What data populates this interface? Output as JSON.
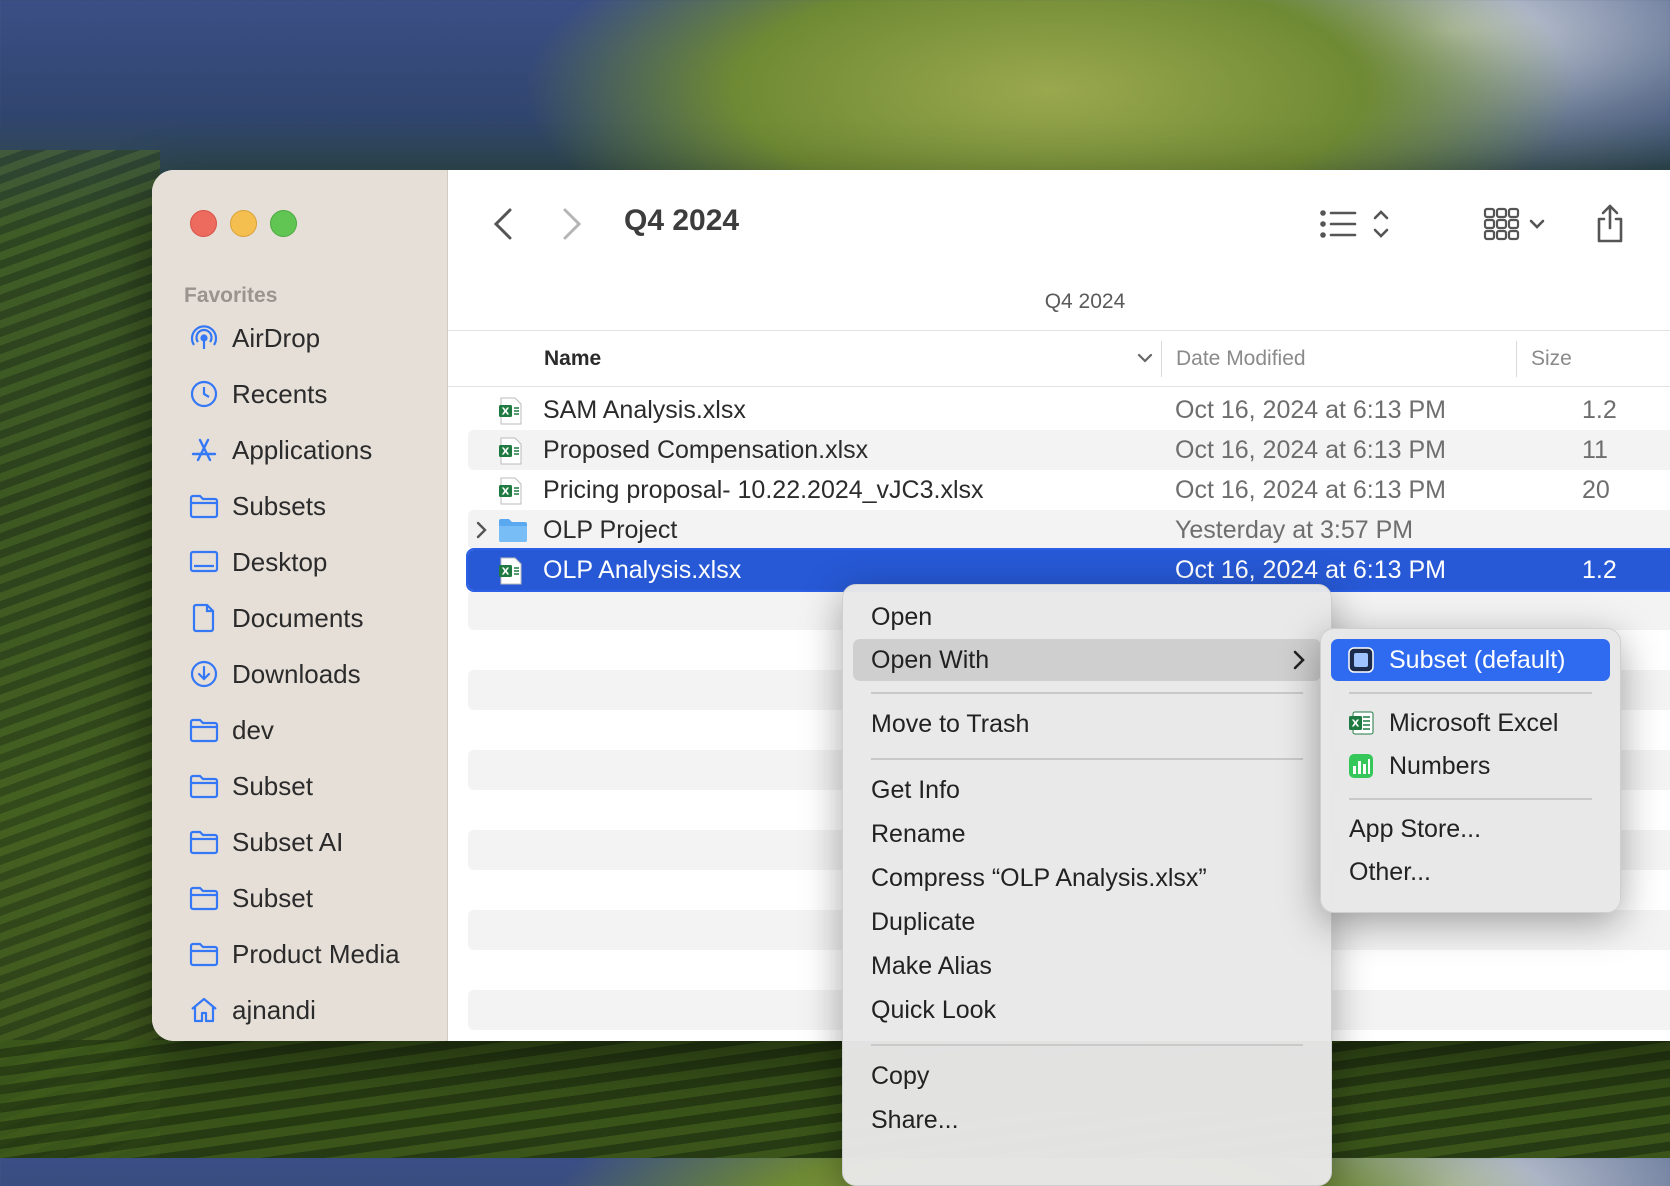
{
  "window": {
    "title": "Q4 2024",
    "path_title": "Q4 2024"
  },
  "sidebar": {
    "section_label": "Favorites",
    "items": [
      {
        "label": "AirDrop",
        "icon": "airdrop-icon"
      },
      {
        "label": "Recents",
        "icon": "clock-icon"
      },
      {
        "label": "Applications",
        "icon": "applications-icon"
      },
      {
        "label": "Subsets",
        "icon": "folder-icon"
      },
      {
        "label": "Desktop",
        "icon": "desktop-icon"
      },
      {
        "label": "Documents",
        "icon": "document-icon"
      },
      {
        "label": "Downloads",
        "icon": "download-icon"
      },
      {
        "label": "dev",
        "icon": "folder-icon"
      },
      {
        "label": "Subset",
        "icon": "folder-icon"
      },
      {
        "label": "Subset AI",
        "icon": "folder-icon"
      },
      {
        "label": "Subset",
        "icon": "folder-icon"
      },
      {
        "label": "Product Media",
        "icon": "folder-icon"
      },
      {
        "label": "ajnandi",
        "icon": "home-icon"
      }
    ]
  },
  "columns": {
    "name": "Name",
    "date": "Date Modified",
    "size": "Size"
  },
  "files": [
    {
      "name": "SAM Analysis.xlsx",
      "date": "Oct 16, 2024 at 6:13 PM",
      "size": "1.2",
      "type": "excel"
    },
    {
      "name": "Proposed Compensation.xlsx",
      "date": "Oct 16, 2024 at 6:13 PM",
      "size": "11",
      "type": "excel"
    },
    {
      "name": "Pricing proposal- 10.22.2024_vJC3.xlsx",
      "date": "Oct 16, 2024 at 6:13 PM",
      "size": "20",
      "type": "excel"
    },
    {
      "name": "OLP Project",
      "date": "Yesterday at 3:57 PM",
      "size": "",
      "type": "folder"
    },
    {
      "name": "OLP Analysis.xlsx",
      "date": "Oct 16, 2024 at 6:13 PM",
      "size": "1.2",
      "type": "excel",
      "selected": true
    }
  ],
  "context_menu": {
    "open": "Open",
    "open_with": "Open With",
    "move_to_trash": "Move to Trash",
    "get_info": "Get Info",
    "rename": "Rename",
    "compress": "Compress “OLP Analysis.xlsx”",
    "duplicate": "Duplicate",
    "make_alias": "Make Alias",
    "quick_look": "Quick Look",
    "copy": "Copy",
    "share": "Share..."
  },
  "submenu": {
    "default_app": "Subset (default)",
    "excel": "Microsoft Excel",
    "numbers": "Numbers",
    "app_store": "App Store...",
    "other": "Other..."
  },
  "colors": {
    "selection": "#2759d6",
    "accent": "#2e6bf0",
    "sidebar_icon": "#3478f6"
  }
}
